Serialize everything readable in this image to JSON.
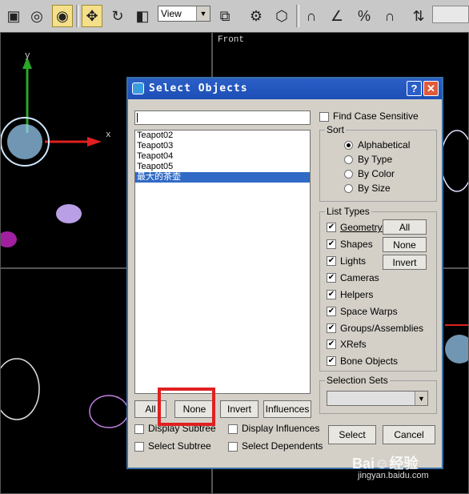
{
  "toolbar": {
    "view_label": "View",
    "buttons": [
      "select-region-icon",
      "lasso-icon",
      "select-object-icon",
      "move-icon",
      "rotate-icon",
      "scale-icon",
      "mirror-icon",
      "link-icon",
      "render-setup-icon",
      "snap-icon",
      "angle-snap-icon",
      "percent-snap-icon",
      "spinner-snap-icon",
      "abc-icon"
    ]
  },
  "viewports": {
    "front_label": "Front",
    "axis_y": "y",
    "axis_x": "x"
  },
  "dialog": {
    "title": "Select Objects",
    "help": "?",
    "close": "✕",
    "search_value": "",
    "list": [
      "Teapot02",
      "Teapot03",
      "Teapot04",
      "Teapot05",
      "最大的茶壶"
    ],
    "selected_index": 4,
    "find_case_sensitive": "Find Case Sensitive",
    "sort": {
      "title": "Sort",
      "options": [
        "Alphabetical",
        "By Type",
        "By Color",
        "By Size"
      ],
      "selected": 0
    },
    "list_types": {
      "title": "List Types",
      "items": [
        "Geometry",
        "Shapes",
        "Lights",
        "Cameras",
        "Helpers",
        "Space Warps",
        "Groups/Assemblies",
        "XRefs",
        "Bone Objects"
      ],
      "buttons": [
        "All",
        "None",
        "Invert"
      ]
    },
    "selection_sets": {
      "title": "Selection Sets",
      "value": ""
    },
    "bottom_buttons": [
      "All",
      "None",
      "Invert",
      "Influences"
    ],
    "display_subtree": "Display Subtree",
    "display_influences": "Display Influences",
    "select_subtree": "Select Subtree",
    "select_dependents": "Select Dependents",
    "select": "Select",
    "cancel": "Cancel"
  },
  "watermark": {
    "brand": "Bai☺经验",
    "url": "jingyan.baidu.com"
  },
  "colors": {
    "title_bar": "#2b5fc7",
    "highlight": "#e02020",
    "list_selected": "#316ac5"
  }
}
